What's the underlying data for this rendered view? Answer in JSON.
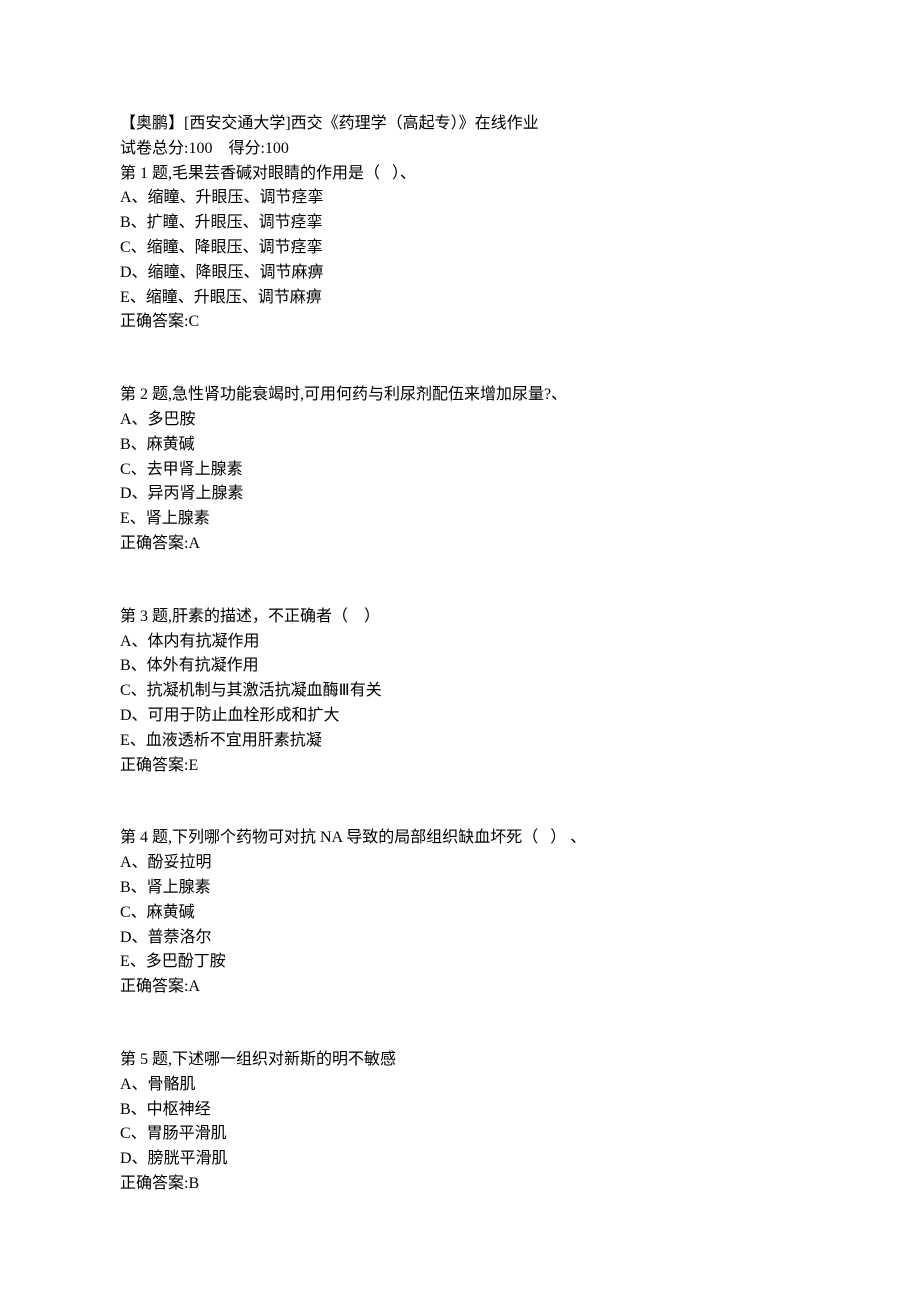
{
  "header": {
    "title": "【奥鹏】[西安交通大学]西交《药理学（高起专）》在线作业",
    "scoreline": "试卷总分:100    得分:100"
  },
  "questions": [
    {
      "stem": "第 1 题,毛果芸香碱对眼睛的作用是（   ）、",
      "options": [
        "A、缩瞳、升眼压、调节痉挛",
        "B、扩瞳、升眼压、调节痉挛",
        "C、缩瞳、降眼压、调节痉挛",
        "D、缩瞳、降眼压、调节麻痹",
        "E、缩瞳、升眼压、调节麻痹"
      ],
      "answer": "正确答案:C"
    },
    {
      "stem": "第 2 题,急性肾功能衰竭时,可用何药与利尿剂配伍来增加尿量?、",
      "options": [
        "A、多巴胺",
        "B、麻黄碱",
        "C、去甲肾上腺素",
        "D、异丙肾上腺素",
        "E、肾上腺素"
      ],
      "answer": "正确答案:A"
    },
    {
      "stem": "第 3 题,肝素的描述，不正确者（    ）",
      "options": [
        "A、体内有抗凝作用",
        "B、体外有抗凝作用",
        "C、抗凝机制与其激活抗凝血酶Ⅲ有关",
        "D、可用于防止血栓形成和扩大",
        "E、血液透析不宜用肝素抗凝"
      ],
      "answer": "正确答案:E"
    },
    {
      "stem": "第 4 题,下列哪个药物可对抗 NA 导致的局部组织缺血坏死（   ） 、",
      "options": [
        "A、酚妥拉明",
        "B、肾上腺素",
        "C、麻黄碱",
        "D、普萘洛尔",
        "E、多巴酚丁胺"
      ],
      "answer": "正确答案:A"
    },
    {
      "stem": "第 5 题,下述哪一组织对新斯的明不敏感",
      "options": [
        "A、骨骼肌",
        "B、中枢神经",
        "C、胃肠平滑肌",
        "D、膀胱平滑肌"
      ],
      "answer": "正确答案:B"
    }
  ]
}
